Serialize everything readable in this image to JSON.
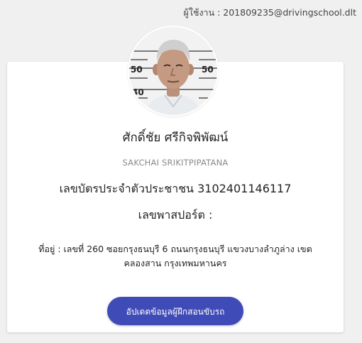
{
  "header": {
    "user_line": "ผู้ใช้งาน : 201809235@drivingschool.dlt"
  },
  "profile": {
    "name_thai": "ศักดิ์ชัย ศรีกิจพิพัฒน์",
    "name_eng": "SAKCHAI SRIKITPIPATANA",
    "id_line": "เลขบัตรประจำตัวประชาชน 3102401146117",
    "passport_line": "เลขพาสปอร์ต :",
    "address": "ที่อยู่ : เลขที่ 260 ซอยกรุงธนบุรี 6 ถนนกรุงธนบุรี แขวงบางลำภูล่าง เขต คลองสาน กรุงเทพมหานคร",
    "photo_ruler_labels": [
      "50",
      "50",
      "40"
    ]
  },
  "actions": {
    "update_label": "อัปเดตข้อมูลผู้ฝึกสอนขับรถ"
  },
  "colors": {
    "button": "#3f4bb6",
    "page_bg": "#f0f0f0",
    "card_bg": "#ffffff"
  }
}
